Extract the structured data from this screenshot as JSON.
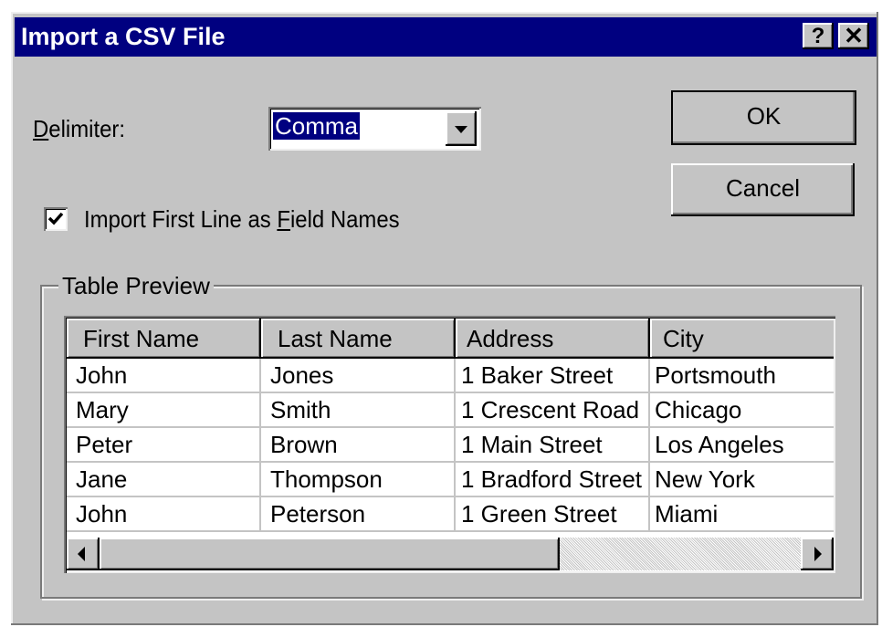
{
  "window": {
    "title": "Import a CSV File",
    "help_glyph": "?",
    "close_glyph": "✕"
  },
  "delimiter": {
    "label_mnemonic": "D",
    "label_rest": "elimiter:",
    "selected": "Comma"
  },
  "buttons": {
    "ok_label": "OK",
    "cancel_label": "Cancel"
  },
  "first_line_option": {
    "label_before": "Import First Line as ",
    "label_mnemonic": "F",
    "label_after": "ield Names",
    "checked": true
  },
  "table_preview": {
    "group_label": "Table Preview",
    "columns": [
      "First Name",
      "Last Name",
      "Address",
      "City"
    ],
    "rows": [
      [
        "John",
        "Jones",
        "1 Baker Street",
        "Portsmouth"
      ],
      [
        "Mary",
        "Smith",
        "1 Crescent Road",
        "Chicago"
      ],
      [
        "Peter",
        "Brown",
        "1 Main Street",
        "Los Angeles"
      ],
      [
        "Jane",
        "Thompson",
        "1 Bradford Street",
        "New York"
      ],
      [
        "John",
        "Peterson",
        "1 Green Street",
        "Miami"
      ]
    ],
    "horizontal_scroll_fraction": 0.6
  },
  "colors": {
    "title_bar": "#000080",
    "dialog_face": "#c4c4c4",
    "selection": "#000080"
  }
}
